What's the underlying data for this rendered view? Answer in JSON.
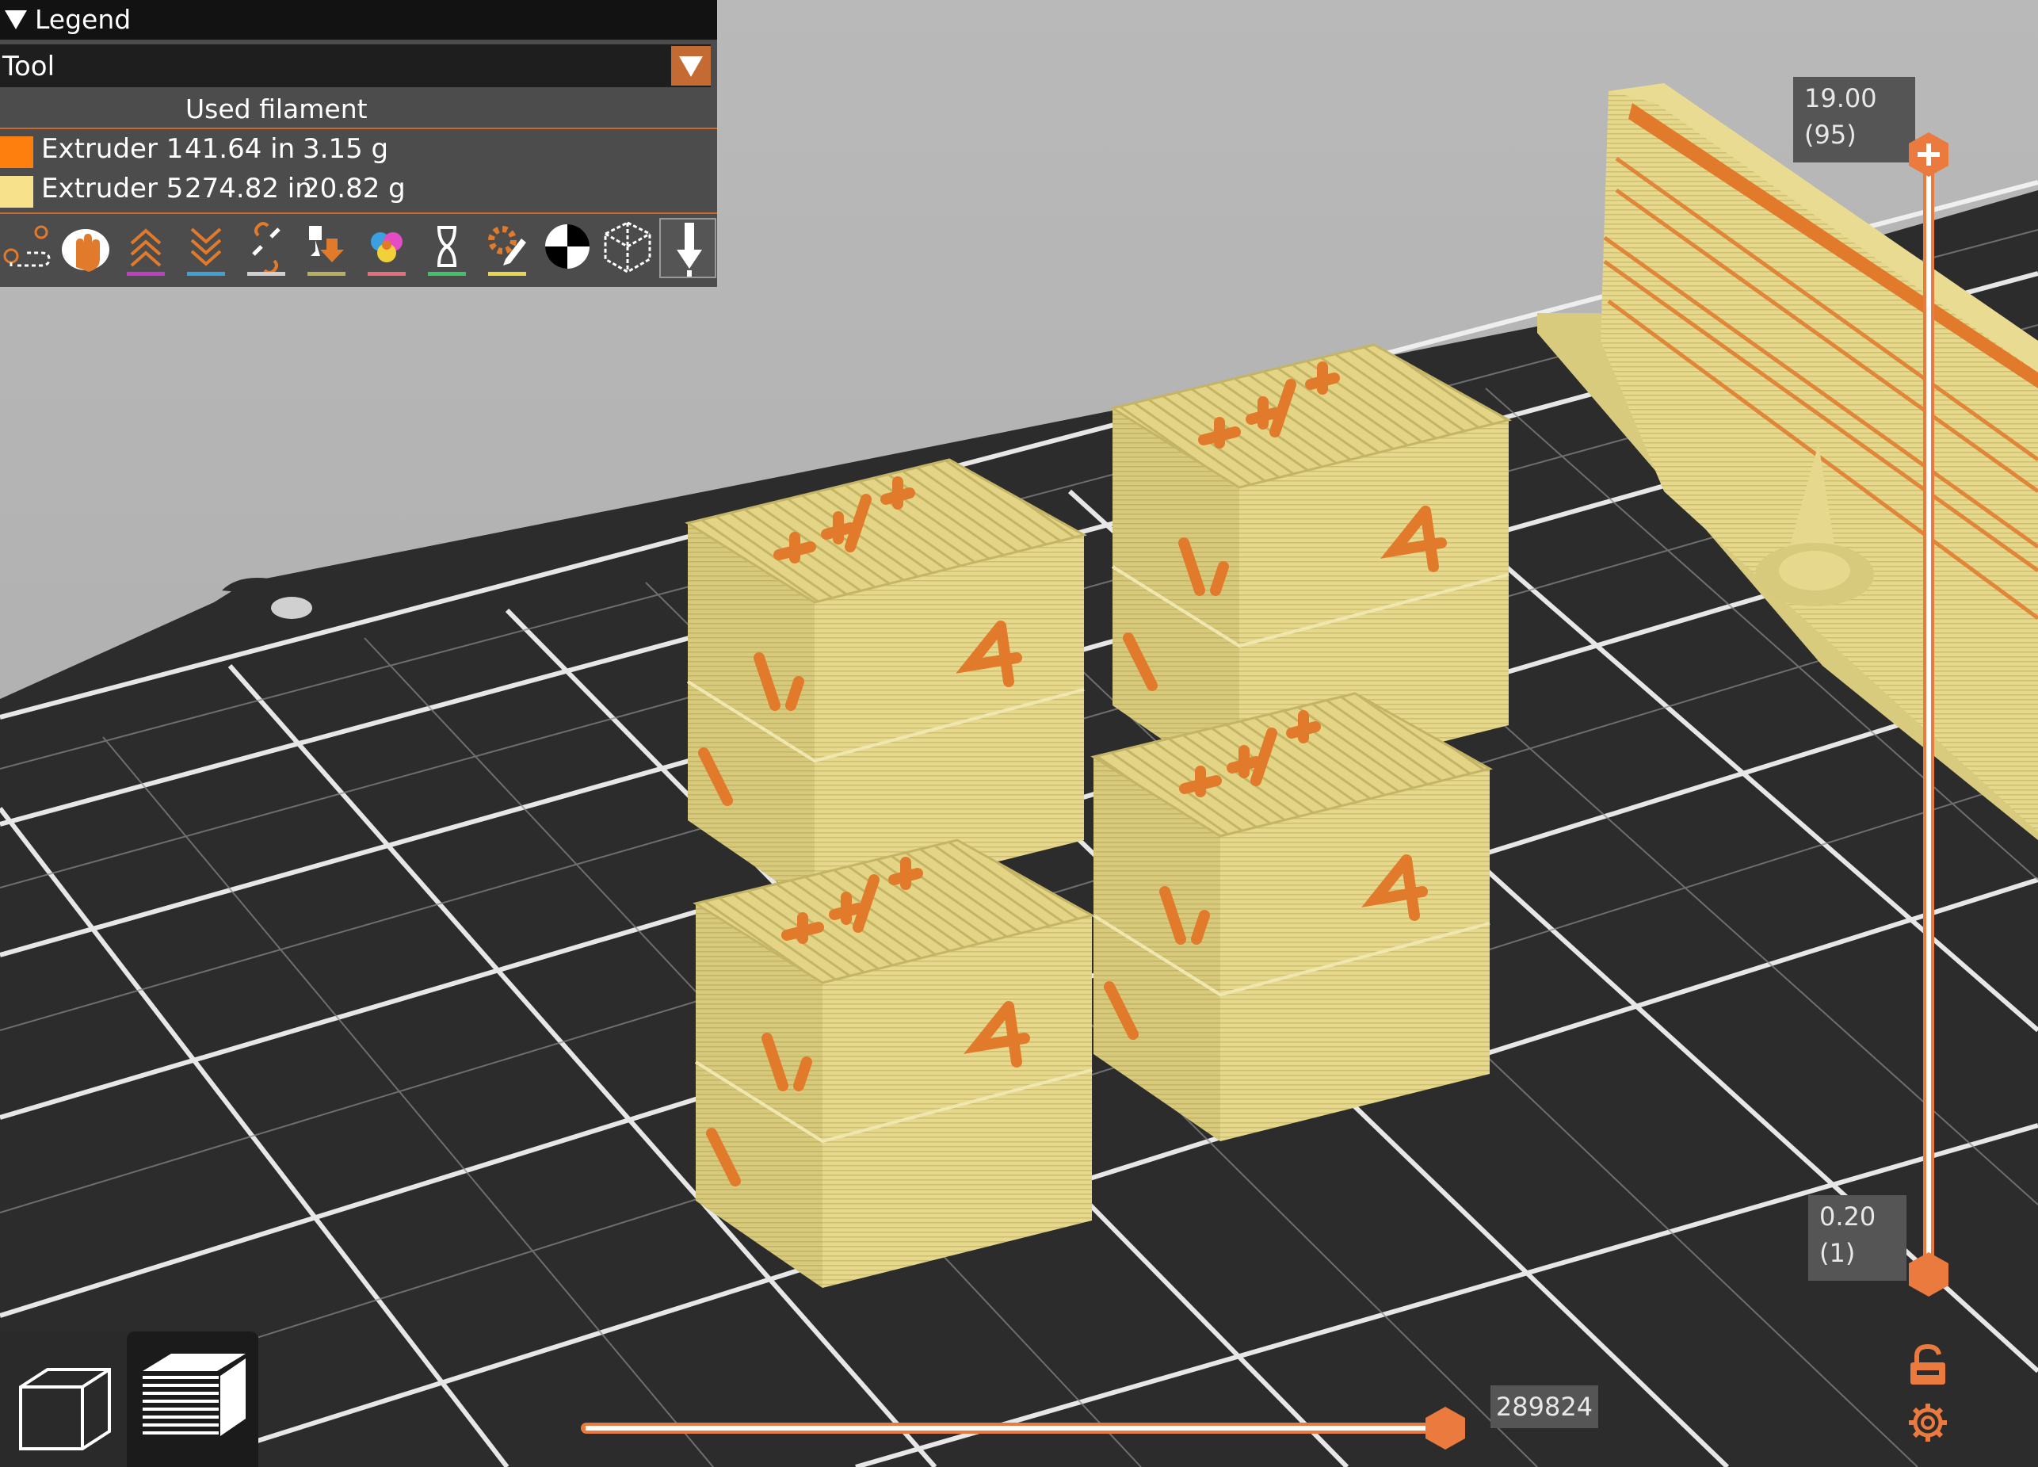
{
  "legend": {
    "title": "Legend",
    "view_type": "Tool",
    "header": "Used filament",
    "extruders": [
      {
        "name": "Extruder 1",
        "length": "41.64 in",
        "weight": "3.15 g",
        "color": "#ff7f0e"
      },
      {
        "name": "Extruder 5",
        "length": "274.82 in",
        "weight": "20.82 g",
        "color": "#f7e18a"
      }
    ],
    "toolbar_icons": [
      "travel-icon",
      "wipe-icon",
      "retractions-icon",
      "deretractions-icon",
      "seams-icon",
      "tool-changes-icon",
      "color-changes-icon",
      "pause-icon",
      "custom-gcode-icon",
      "center-of-gravity-icon",
      "shells-icon",
      "tool-marker-icon"
    ]
  },
  "vertical_slider": {
    "top_value": "19.00",
    "top_layer": "(95)",
    "bottom_value": "0.20",
    "bottom_layer": "(1)"
  },
  "horizontal_slider": {
    "value": "289824"
  },
  "accent_color": "#ea7a3e",
  "view_toggle": {
    "options": [
      "3d-view-icon",
      "layers-view-icon"
    ],
    "selected": "layers-view-icon"
  }
}
